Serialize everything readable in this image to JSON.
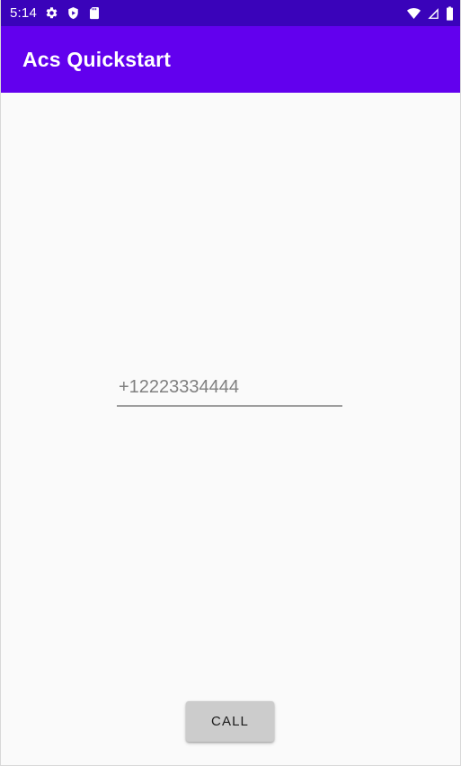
{
  "theme": {
    "status_bar_color": "#3a03ba",
    "app_bar_color": "#6200ee",
    "background_color": "#fafafa",
    "button_color": "#cccccc",
    "hint_text_color": "#808080"
  },
  "status_bar": {
    "time": "5:14",
    "left_icons": [
      {
        "name": "settings-gear-icon"
      },
      {
        "name": "play-protect-shield-icon"
      },
      {
        "name": "sd-card-icon"
      }
    ],
    "right_icons": [
      {
        "name": "wifi-icon"
      },
      {
        "name": "cellular-signal-icon"
      },
      {
        "name": "battery-icon"
      }
    ]
  },
  "app_bar": {
    "title": "Acs Quickstart"
  },
  "main": {
    "phone_input": {
      "value": "",
      "placeholder": "+12223334444"
    },
    "call_button": {
      "label": "CALL"
    }
  }
}
